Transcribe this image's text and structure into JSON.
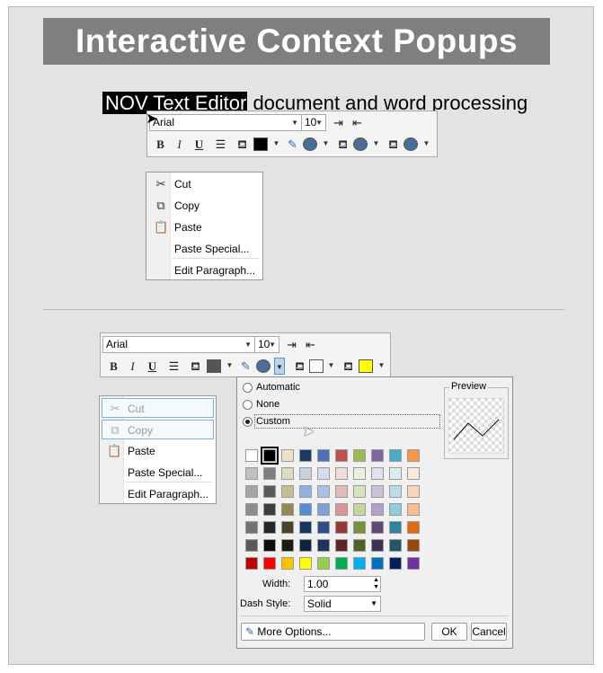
{
  "banner": {
    "title": "Interactive  Context Popups"
  },
  "headline": {
    "selected": "NOV Text Editor",
    "rest": " document and word processing"
  },
  "mini_toolbar": {
    "font_name": "Arial",
    "font_size": "10",
    "bold": "B",
    "italic": "I",
    "underline": "U",
    "text_color": "#000000",
    "fill_color": "#4a6f96"
  },
  "bottom_toolbar": {
    "font_name": "Arial",
    "font_size": "10",
    "bold": "B",
    "italic": "I",
    "underline": "U",
    "text_color": "#555555",
    "fill_color": "#4a6f96",
    "outline_color": "#ffffff",
    "highlight_color": "#ffff00"
  },
  "context_menu_top": {
    "items": [
      {
        "label": "Cut",
        "icon": "scissors-icon",
        "enabled": true
      },
      {
        "label": "Copy",
        "icon": "copy-icon",
        "enabled": true
      },
      {
        "label": "Paste",
        "icon": "paste-icon",
        "enabled": true
      },
      {
        "label": "Paste Special...",
        "icon": "",
        "enabled": true
      },
      {
        "label": "Edit Paragraph...",
        "icon": "",
        "enabled": true
      }
    ]
  },
  "context_menu_bottom": {
    "items": [
      {
        "label": "Cut",
        "icon": "scissors-icon",
        "enabled": false
      },
      {
        "label": "Copy",
        "icon": "copy-icon",
        "enabled": false
      },
      {
        "label": "Paste",
        "icon": "paste-icon",
        "enabled": true
      },
      {
        "label": "Paste Special...",
        "icon": "",
        "enabled": true
      },
      {
        "label": "Edit Paragraph...",
        "icon": "",
        "enabled": true
      }
    ]
  },
  "color_panel": {
    "options": {
      "automatic": "Automatic",
      "none": "None",
      "custom": "Custom"
    },
    "selected_option": "custom",
    "preview_label": "Preview",
    "width_label": "Width:",
    "width_value": "1.00",
    "dash_label": "Dash Style:",
    "dash_value": "Solid",
    "more_options": "More Options...",
    "ok": "OK",
    "cancel": "Cancel",
    "selected_color": "#000000",
    "grid": [
      [
        "#ffffff",
        "#000000",
        "#eee1c7",
        "#1f3864",
        "#4f71b8",
        "#c0504d",
        "#9bbb59",
        "#8064a2",
        "#4bacc6",
        "#f79646"
      ],
      [
        "#bfbfbf",
        "#7f7f7f",
        "#ddd9c3",
        "#c6d0df",
        "#d3dff1",
        "#f2dcdb",
        "#ebf1dd",
        "#e5e0ec",
        "#dbeef3",
        "#fdeada"
      ],
      [
        "#a5a5a5",
        "#595959",
        "#c4bd97",
        "#8db3e2",
        "#a8c0e5",
        "#e5b9b7",
        "#d7e3bc",
        "#ccc1d9",
        "#b7dde8",
        "#fbd5b5"
      ],
      [
        "#8c8c8c",
        "#3f3f3f",
        "#938953",
        "#548dd4",
        "#7ea1da",
        "#d99694",
        "#c3d69b",
        "#b2a2c7",
        "#92cddc",
        "#fac08f"
      ],
      [
        "#737373",
        "#262626",
        "#494429",
        "#17365d",
        "#2f4d8a",
        "#953734",
        "#76923c",
        "#5f497a",
        "#31859b",
        "#e36c09"
      ],
      [
        "#595959",
        "#0c0c0c",
        "#1d1b10",
        "#0f243e",
        "#1f325c",
        "#632423",
        "#4f6128",
        "#3f3151",
        "#205867",
        "#974806"
      ],
      [
        "#c00000",
        "#ff0000",
        "#ffc000",
        "#ffff00",
        "#92d050",
        "#00b050",
        "#00b0f0",
        "#0070c0",
        "#002060",
        "#7030a0"
      ]
    ]
  }
}
